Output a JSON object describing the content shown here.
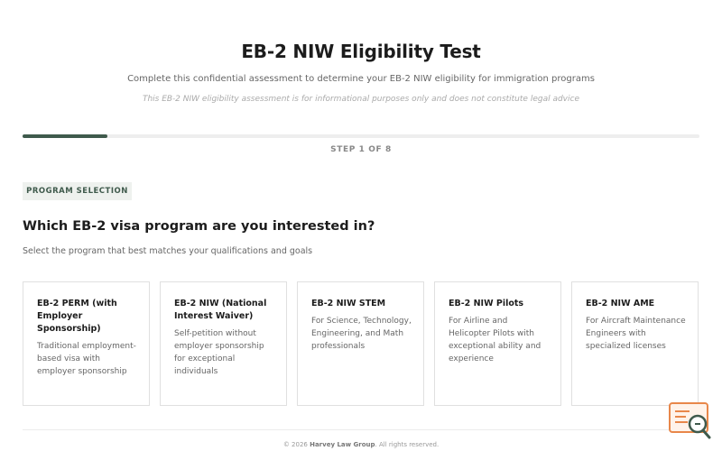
{
  "header": {
    "title": "EB-2 NIW Eligibility Test",
    "subtitle": "Complete this confidential assessment to determine your EB-2 NIW eligibility for immigration programs",
    "disclaimer": "This EB-2 NIW eligibility assessment is for informational purposes only and does not constitute legal advice"
  },
  "progress": {
    "current_step": 1,
    "total_steps": 8,
    "fraction": 0.125,
    "label": "STEP 1 OF 8",
    "color": "#3f5a4c"
  },
  "section": {
    "badge": "PROGRAM SELECTION"
  },
  "question": {
    "text": "Which EB-2 visa program are you interested in?",
    "hint": "Select the program that best matches your qualifications and goals"
  },
  "options": [
    {
      "title": "EB-2 PERM (with Employer Sponsorship)",
      "description": "Traditional employment-based visa with employer sponsorship"
    },
    {
      "title": "EB-2 NIW (National Interest Waiver)",
      "description": "Self-petition without employer sponsorship for exceptional individuals"
    },
    {
      "title": "EB-2 NIW STEM",
      "description": "For Science, Technology, Engineering, and Math professionals"
    },
    {
      "title": "EB-2 NIW Pilots",
      "description": "For Airline and Helicopter Pilots with exceptional ability and experience"
    },
    {
      "title": "EB-2 NIW AME",
      "description": "For Aircraft Maintenance Engineers with specialized licenses"
    }
  ],
  "footer": {
    "copyright_prefix": "© 2026",
    "company": "Harvey Law Group",
    "rights": ". All rights reserved."
  },
  "help_widget": {
    "icon": "search-chat-icon",
    "accent": "#e8874a"
  }
}
